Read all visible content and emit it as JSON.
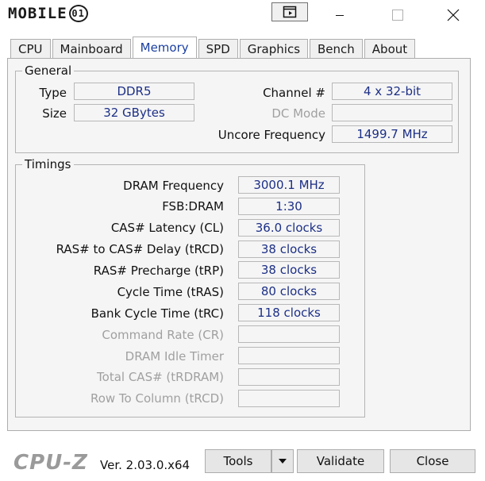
{
  "window": {
    "logo_text": "MOBILE",
    "logo_mark": "01",
    "controls": [
      "minimize",
      "maximize",
      "close"
    ]
  },
  "tabs": [
    {
      "label": "CPU"
    },
    {
      "label": "Mainboard"
    },
    {
      "label": "Memory",
      "active": true
    },
    {
      "label": "SPD"
    },
    {
      "label": "Graphics"
    },
    {
      "label": "Bench"
    },
    {
      "label": "About"
    }
  ],
  "general": {
    "title": "General",
    "type_label": "Type",
    "type_value": "DDR5",
    "size_label": "Size",
    "size_value": "32 GBytes",
    "channel_label": "Channel #",
    "channel_value": "4 x 32-bit",
    "dcmode_label": "DC Mode",
    "dcmode_value": "",
    "uncore_label": "Uncore Frequency",
    "uncore_value": "1499.7 MHz"
  },
  "timings": {
    "title": "Timings",
    "rows": [
      {
        "label": "DRAM Frequency",
        "value": "3000.1 MHz",
        "enabled": true
      },
      {
        "label": "FSB:DRAM",
        "value": "1:30",
        "enabled": true
      },
      {
        "label": "CAS# Latency (CL)",
        "value": "36.0 clocks",
        "enabled": true
      },
      {
        "label": "RAS# to CAS# Delay (tRCD)",
        "value": "38 clocks",
        "enabled": true
      },
      {
        "label": "RAS# Precharge (tRP)",
        "value": "38 clocks",
        "enabled": true
      },
      {
        "label": "Cycle Time (tRAS)",
        "value": "80 clocks",
        "enabled": true
      },
      {
        "label": "Bank Cycle Time (tRC)",
        "value": "118 clocks",
        "enabled": true
      },
      {
        "label": "Command Rate (CR)",
        "value": "",
        "enabled": false
      },
      {
        "label": "DRAM Idle Timer",
        "value": "",
        "enabled": false
      },
      {
        "label": "Total CAS# (tRDRAM)",
        "value": "",
        "enabled": false
      },
      {
        "label": "Row To Column (tRCD)",
        "value": "",
        "enabled": false
      }
    ]
  },
  "footer": {
    "brand": "CPU-Z",
    "version": "Ver. 2.03.0.x64",
    "tools_label": "Tools",
    "validate_label": "Validate",
    "close_label": "Close"
  }
}
